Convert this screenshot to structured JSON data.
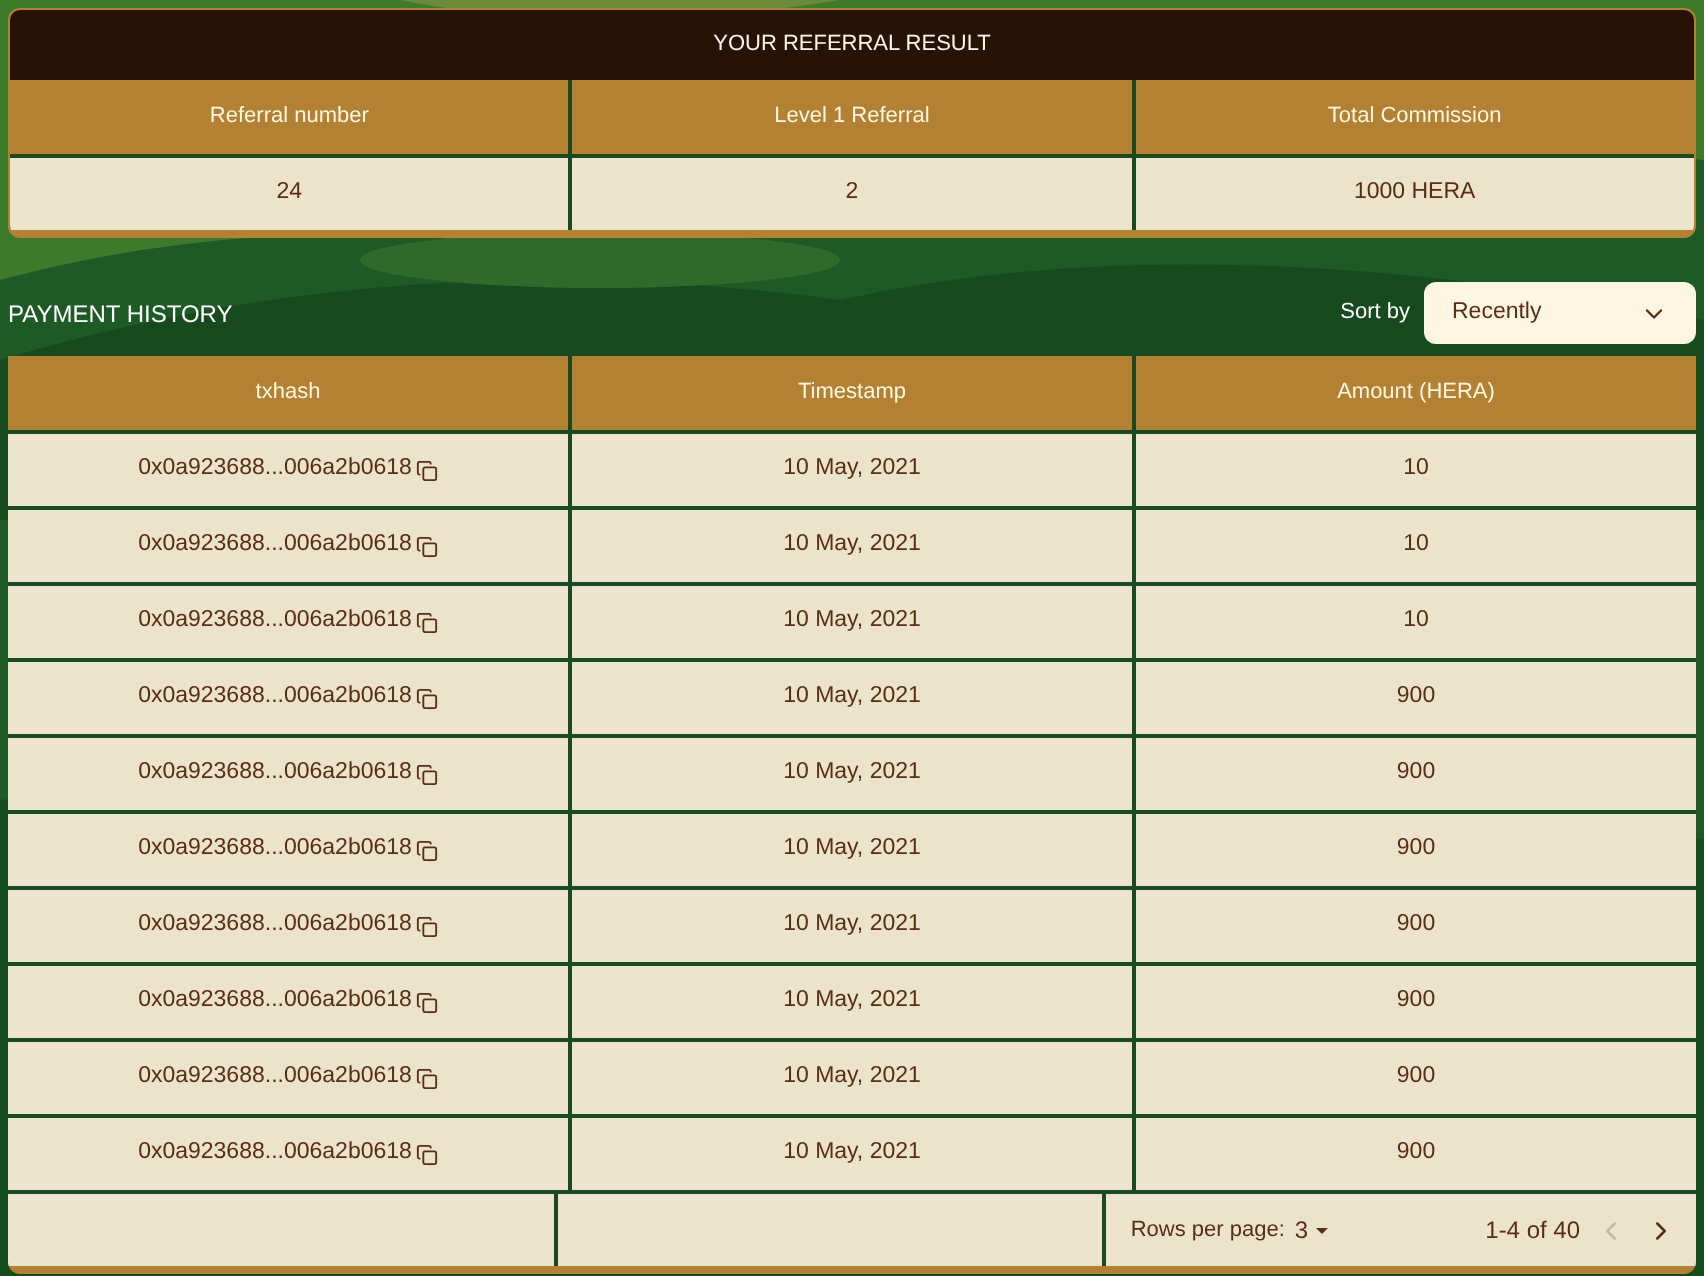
{
  "referral": {
    "title": "YOUR REFERRAL RESULT",
    "columns": [
      "Referral number",
      "Level 1 Referral",
      "Total Commission"
    ],
    "values": [
      "24",
      "2",
      "1000 HERA"
    ]
  },
  "payment_history": {
    "title": "PAYMENT HISTORY",
    "sort_label": "Sort by",
    "sort_value": "Recently",
    "columns": [
      "txhash",
      "Timestamp",
      "Amount (HERA)"
    ],
    "rows": [
      {
        "txhash": "0x0a923688...006a2b0618",
        "timestamp": "10 May, 2021",
        "amount": "10"
      },
      {
        "txhash": "0x0a923688...006a2b0618",
        "timestamp": "10 May, 2021",
        "amount": "10"
      },
      {
        "txhash": "0x0a923688...006a2b0618",
        "timestamp": "10 May, 2021",
        "amount": "10"
      },
      {
        "txhash": "0x0a923688...006a2b0618",
        "timestamp": "10 May, 2021",
        "amount": "900"
      },
      {
        "txhash": "0x0a923688...006a2b0618",
        "timestamp": "10 May, 2021",
        "amount": "900"
      },
      {
        "txhash": "0x0a923688...006a2b0618",
        "timestamp": "10 May, 2021",
        "amount": "900"
      },
      {
        "txhash": "0x0a923688...006a2b0618",
        "timestamp": "10 May, 2021",
        "amount": "900"
      },
      {
        "txhash": "0x0a923688...006a2b0618",
        "timestamp": "10 May, 2021",
        "amount": "900"
      },
      {
        "txhash": "0x0a923688...006a2b0618",
        "timestamp": "10 May, 2021",
        "amount": "900"
      },
      {
        "txhash": "0x0a923688...006a2b0618",
        "timestamp": "10 May, 2021",
        "amount": "900"
      }
    ],
    "pagination": {
      "rows_per_page_label": "Rows per page:",
      "rows_per_page": "3",
      "range": "1-4 of 40",
      "prev_disabled": true,
      "next_disabled": false
    }
  }
}
